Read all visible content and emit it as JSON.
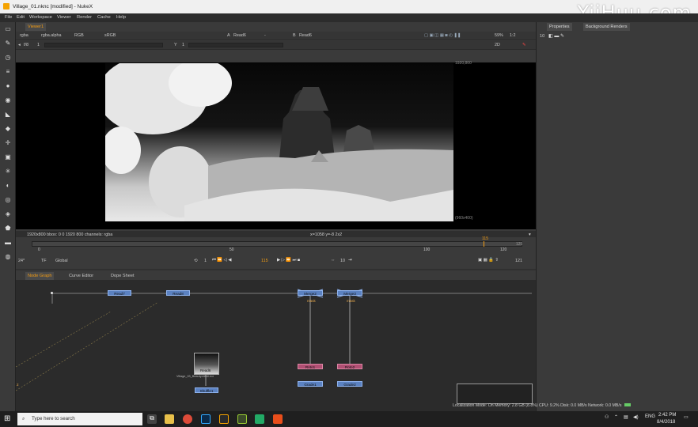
{
  "window": {
    "title": "Village_01.nknc [modified] - NukeX"
  },
  "watermark": "YiiHuu.com",
  "menu": [
    "File",
    "Edit",
    "Workspace",
    "Viewer",
    "Render",
    "Cache",
    "Help"
  ],
  "viewer": {
    "tab": "Viewer1",
    "row1": {
      "channels": "rgba",
      "layer": "rgba.alpha",
      "colorspace_rgb": "RGB",
      "colorspace": "sRGB",
      "input_a_label": "A",
      "input_a": "Read6",
      "dash": "-",
      "input_b_label": "B",
      "input_b": "Read6",
      "zoom_pct": "59%",
      "proxy": "1:2"
    },
    "row2": {
      "fstop": "f/8",
      "fstop_val": "1",
      "gamma_label": "Y",
      "gamma_val": "1",
      "view": "2D"
    },
    "format_top": "1920,800",
    "format_bottom": "(960x400)",
    "status_left": "1920x800  bbox: 0 0 1920 800 channels: rgba",
    "status_mid": "x=1058 y=-8 2x2"
  },
  "timeline": {
    "ticks": [
      "0",
      "50",
      "100",
      "120",
      "125"
    ],
    "current_frame_marker": "115",
    "fps": "24*",
    "tf": "TF",
    "global": "Global",
    "frame": "115",
    "step": "1",
    "increment": "10",
    "end_frame": "121"
  },
  "panels": {
    "node_graph_tabs": [
      "Node Graph",
      "Curve Editor",
      "Dope Sheet"
    ],
    "properties_tabs": [
      "Properties",
      "Background Renders"
    ],
    "properties_count": "10"
  },
  "nodes": {
    "read_labels": [
      "Read7",
      "Read8",
      "Merge2",
      "Merge3"
    ],
    "mask_labels": [
      "mask",
      "mask"
    ],
    "grade_nodes": [
      "Grade1",
      "Grade2"
    ],
    "roto_nodes": [
      "Roto1",
      "Roto2"
    ],
    "shuffle_node": "Shuffle1",
    "read_thumb_label": "Read6",
    "read_thumb_caption": "Village_03_Beauty.####.exr",
    "side_number": "2"
  },
  "status_bar": {
    "localization": "Localization Mode: On",
    "memory": "Memory: 2.8 GB (8.8%)",
    "cpu": "CPU: 9.2%",
    "disk": "Disk: 0.0 MB/s",
    "network": "Network: 0.0 MB/s"
  },
  "taskbar": {
    "search_placeholder": "Type here to search",
    "language": "ENG",
    "time": "2:42 PM",
    "date": "8/4/2018"
  }
}
